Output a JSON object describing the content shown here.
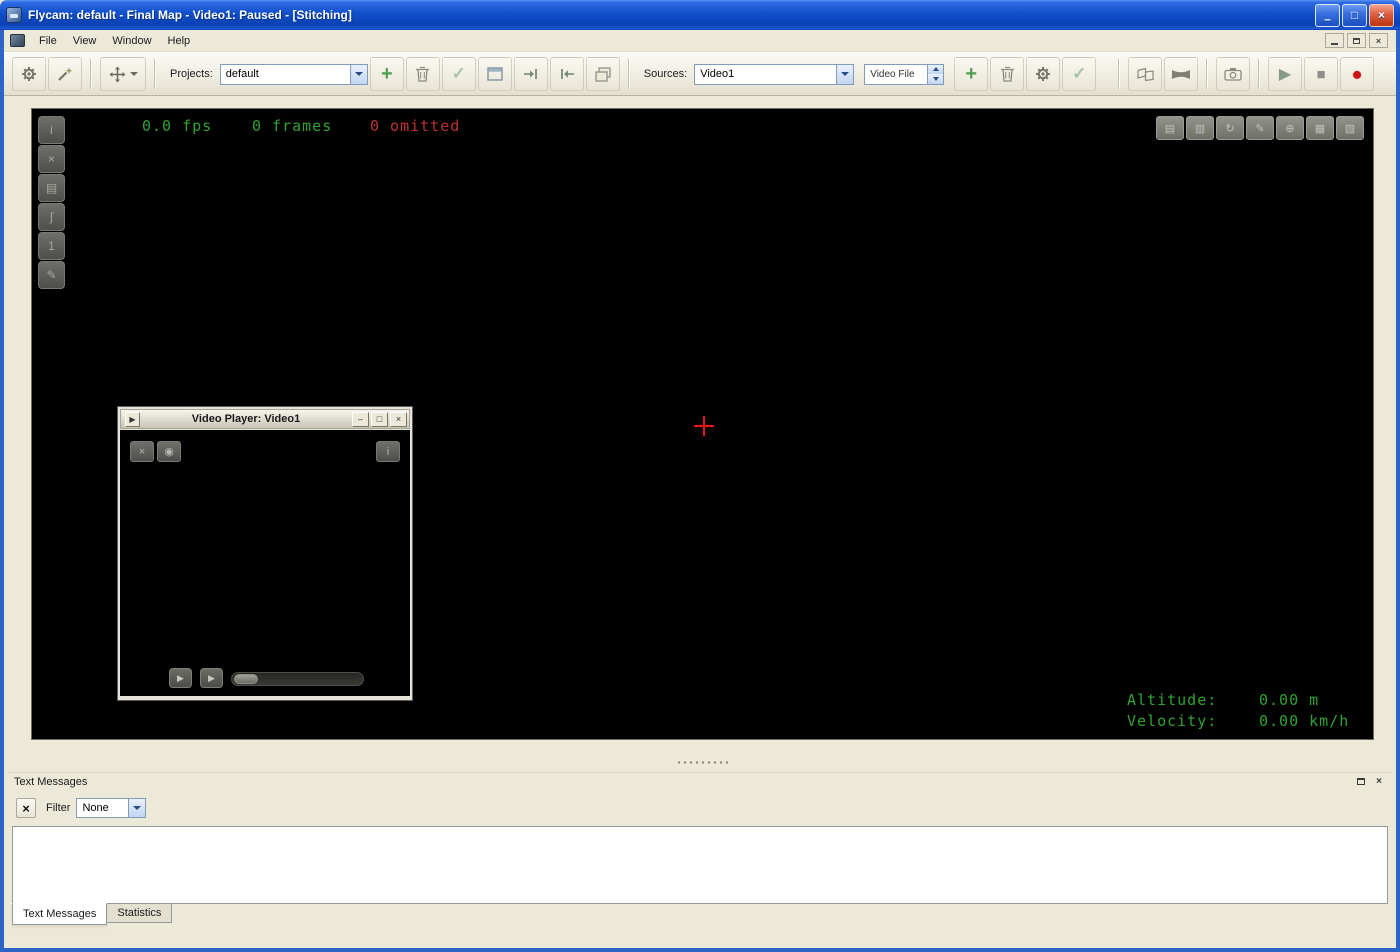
{
  "titlebar": {
    "title": "Flycam: default - Final Map - Video1: Paused - [Stitching]"
  },
  "menubar": {
    "items": [
      "File",
      "View",
      "Window",
      "Help"
    ]
  },
  "toolbar": {
    "projects_label": "Projects:",
    "projects_value": "default",
    "sources_label": "Sources:",
    "sources_value": "Video1",
    "source_type_value": "Video File"
  },
  "viewport": {
    "fps": "0.0 fps",
    "frames": "0 frames",
    "omitted": "0 omitted",
    "altitude_label": "Altitude:",
    "altitude_value": "0.00 m",
    "velocity_label": "Velocity:",
    "velocity_value": "0.00 km/h"
  },
  "video_player": {
    "title": "Video Player: Video1"
  },
  "messages": {
    "panel_title": "Text Messages",
    "filter_label": "Filter",
    "filter_value": "None",
    "tabs": [
      "Text Messages",
      "Statistics"
    ]
  },
  "icons": {
    "minimize": "–",
    "maximize": "□",
    "close": "×",
    "plus": "+",
    "check": "✓",
    "play": "▶",
    "stop": "■",
    "record": "●",
    "mdi_close": "×",
    "player_prev": "▶",
    "player_play": "▶",
    "player_min": "–",
    "player_max": "□",
    "player_close": "×",
    "player_title_play": "▶",
    "clear": "×",
    "panel_close": "×",
    "info": "i",
    "vp_left": [
      "i",
      "×",
      "▤",
      "∫",
      "1",
      "✎"
    ],
    "vp_right": [
      "▤",
      "▥",
      "↻",
      "✎",
      "⊕",
      "▦",
      "▧"
    ],
    "player_tl": [
      "×",
      "◉"
    ]
  },
  "colors": {
    "titlebar_blue": "#1250CC",
    "face_gray": "#ECE9D8",
    "hud_green": "#2FA32F",
    "hud_red": "#C03030",
    "record_red": "#CE1212",
    "viewport_black": "#000000"
  }
}
